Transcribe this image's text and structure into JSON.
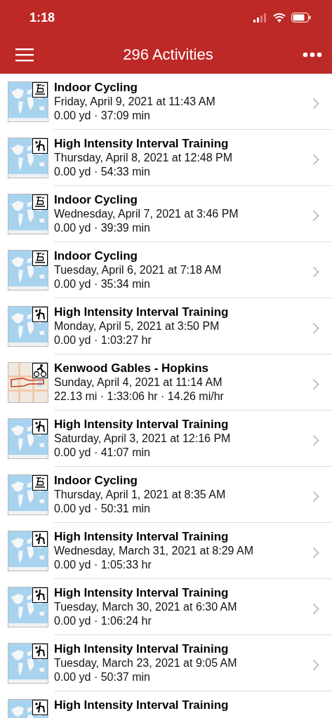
{
  "status_bar": {
    "time": "1:18"
  },
  "nav": {
    "title": "296 Activities"
  },
  "activities": [
    {
      "kind": "indoor_cycling",
      "title": "Indoor Cycling",
      "date": "Friday, April 9, 2021 at 11:43 AM",
      "stats": "0.00 yd · 37:09 min"
    },
    {
      "kind": "hiit",
      "title": "High Intensity Interval Training",
      "date": "Thursday, April 8, 2021 at 12:48 PM",
      "stats": "0.00 yd · 54:33 min"
    },
    {
      "kind": "indoor_cycling",
      "title": "Indoor Cycling",
      "date": "Wednesday, April 7, 2021 at 3:46 PM",
      "stats": "0.00 yd · 39:39 min"
    },
    {
      "kind": "indoor_cycling",
      "title": "Indoor Cycling",
      "date": "Tuesday, April 6, 2021 at 7:18 AM",
      "stats": "0.00 yd · 35:34 min"
    },
    {
      "kind": "hiit",
      "title": "High Intensity Interval Training",
      "date": "Monday, April 5, 2021 at 3:50 PM",
      "stats": "0.00 yd · 1:03:27 hr"
    },
    {
      "kind": "cycling",
      "title": "Kenwood Gables - Hopkins",
      "date": "Sunday, April 4, 2021 at 11:14 AM",
      "stats": "22.13 mi · 1:33:06 hr · 14.26 mi/hr"
    },
    {
      "kind": "hiit",
      "title": "High Intensity Interval Training",
      "date": "Saturday, April 3, 2021 at 12:16 PM",
      "stats": "0.00 yd · 41:07 min"
    },
    {
      "kind": "indoor_cycling",
      "title": "Indoor Cycling",
      "date": "Thursday, April 1, 2021 at 8:35 AM",
      "stats": "0.00 yd · 50:31 min"
    },
    {
      "kind": "hiit",
      "title": "High Intensity Interval Training",
      "date": "Wednesday, March 31, 2021 at 8:29 AM",
      "stats": "0.00 yd · 1:05:33 hr"
    },
    {
      "kind": "hiit",
      "title": "High Intensity Interval Training",
      "date": "Tuesday, March 30, 2021 at 6:30 AM",
      "stats": "0.00 yd · 1:06:24 hr"
    },
    {
      "kind": "hiit",
      "title": "High Intensity Interval Training",
      "date": "Tuesday, March 23, 2021 at 9:05 AM",
      "stats": "0.00 yd · 50:37 min"
    },
    {
      "kind": "hiit",
      "title": "High Intensity Interval Training"
    }
  ]
}
